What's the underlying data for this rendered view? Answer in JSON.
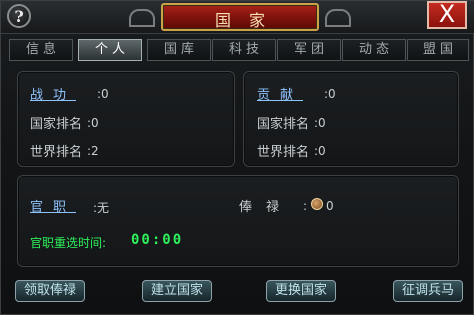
{
  "window": {
    "title": "国家",
    "help_label": "?",
    "close_label": "X"
  },
  "tabs": [
    {
      "label": "信息",
      "active": false
    },
    {
      "label": "个人",
      "active": true
    },
    {
      "label": "国库",
      "active": false
    },
    {
      "label": "科技",
      "active": false
    },
    {
      "label": "军团",
      "active": false
    },
    {
      "label": "动态",
      "active": false
    },
    {
      "label": "盟国",
      "active": false
    }
  ],
  "left_panel": {
    "merit_label": "战功",
    "merit_value": ":0",
    "country_rank_label": "国家排名",
    "country_rank_value": ":0",
    "world_rank_label": "世界排名",
    "world_rank_value": ":2"
  },
  "right_panel": {
    "contribution_label": "贡献",
    "contribution_value": ":0",
    "country_rank_label": "国家排名",
    "country_rank_value": ":0",
    "world_rank_label": "世界排名",
    "world_rank_value": ":0"
  },
  "office_panel": {
    "office_label": "官职",
    "office_value": ":无",
    "salary_label": "俸禄",
    "salary_value": ":",
    "salary_amount": "0",
    "reselect_label": "官职重选时间:",
    "reselect_time": "00:00"
  },
  "buttons": {
    "claim_salary": "领取俸禄",
    "establish_country": "建立国家",
    "change_country": "更换国家",
    "recruit_soldiers": "征调兵马"
  },
  "colors": {
    "accent_link": "#8fc3ff",
    "timer_green": "#2ef05b",
    "title_red": "#a8231b",
    "gold_trim": "#c9a24a"
  }
}
